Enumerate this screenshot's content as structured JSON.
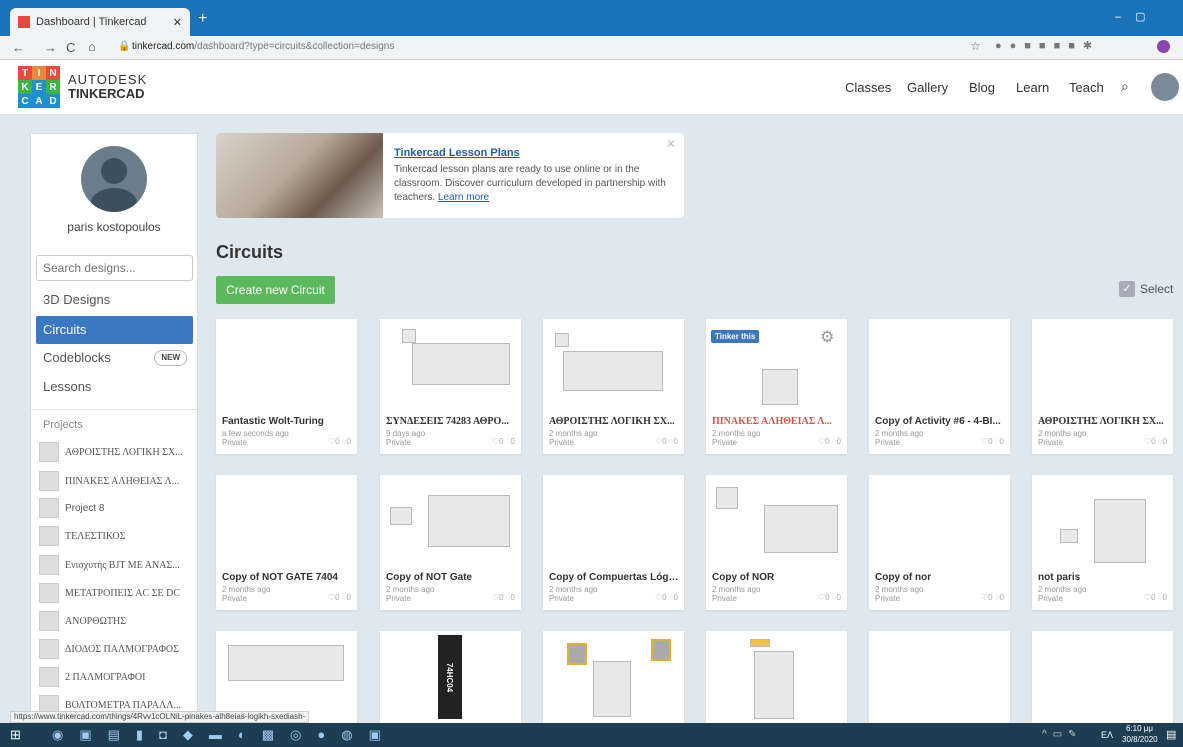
{
  "browser": {
    "tab_title": "Dashboard | Tinkercad",
    "url_host": "tinkercad.com",
    "url_path": "/dashboard?type=circuits&collection=designs",
    "status_url": "https://www.tinkercad.com/things/4Rvv1cOLNiL-pinakes-alh8eias-logikh-sxediash-"
  },
  "header": {
    "logo_letters": [
      "T",
      "I",
      "N",
      "K",
      "E",
      "R",
      "C",
      "A",
      "D"
    ],
    "brand_line1": "AUTODESK",
    "brand_line2": "TINKERCAD",
    "nav": [
      "Classes",
      "Gallery",
      "Blog",
      "Learn",
      "Teach"
    ]
  },
  "sidebar": {
    "username": "paris kostopoulos",
    "search_placeholder": "Search designs...",
    "items": [
      "3D Designs",
      "Circuits",
      "Codeblocks",
      "Lessons"
    ],
    "new_badge": "NEW",
    "projects_label": "Projects",
    "projects": [
      "ΑΘΡΟΙΣΤΗΣ ΛΟΓΙΚΗ ΣΧ...",
      "ΠΙΝΑΚΕΣ ΑΛΗΘΕΙΑΣ Λ...",
      "Project 8",
      "ΤΕΛΕΣΤΙΚΟΣ",
      "Ενισχυτής BJT ΜΕ ΑΝΑΣ...",
      "ΜΕΤΑΤΡΟΠΕΙΣ AC ΣΕ DC",
      "ΑΝΟΡΘΩΤΗΣ",
      "ΔΙΟΔΟΣ ΠΑΛΜΟΓΡΑΦΟΣ",
      "2 ΠΑΛΜΟΓΡΑΦΟΙ",
      "ΒΟΛΤΟΜΕΤΡΑ ΠΑΡΑΛΛ..."
    ]
  },
  "banner": {
    "title": "Tinkercad Lesson Plans",
    "body": "Tinkercad lesson plans are ready to use online or in the classroom. Discover curriculum developed in partnership with teachers.",
    "link": "Learn more"
  },
  "main": {
    "heading": "Circuits",
    "create_button": "Create new Circuit",
    "select_label": "Select",
    "tinker_badge": "Tinker this",
    "stats": "♡0 ◌0"
  },
  "cards": [
    {
      "title": "Fantastic Wolt-Turing",
      "date": "a few seconds ago",
      "privacy": "Private"
    },
    {
      "title": "ΣΥΝΔΕΣΕΙΣ 74283 ΑΘΡΟ...",
      "date": "9 days ago",
      "privacy": "Private"
    },
    {
      "title": "ΑΘΡΟΙΣΤΗΣ ΛΟΓΙΚΗ ΣΧ...",
      "date": "2 months ago",
      "privacy": "Private"
    },
    {
      "title": "ΠΙΝΑΚΕΣ ΑΛΗΘΕΙΑΣ Λ...",
      "date": "2 months ago",
      "privacy": "Private"
    },
    {
      "title": "Copy of Activity #6 - 4-BI...",
      "date": "2 months ago",
      "privacy": "Private"
    },
    {
      "title": "ΑΘΡΟΙΣΤΗΣ ΛΟΓΙΚΗ ΣΧ...",
      "date": "2 months ago",
      "privacy": "Private"
    },
    {
      "title": "Copy of NOT GATE 7404",
      "date": "2 months ago",
      "privacy": "Private"
    },
    {
      "title": "Copy of NOT Gate",
      "date": "2 months ago",
      "privacy": "Private"
    },
    {
      "title": "Copy of Compuertas Lógi...",
      "date": "2 months ago",
      "privacy": "Private"
    },
    {
      "title": "Copy of NOR",
      "date": "2 months ago",
      "privacy": "Private"
    },
    {
      "title": "Copy of nor",
      "date": "2 months ago",
      "privacy": "Private"
    },
    {
      "title": "not paris",
      "date": "2 months ago",
      "privacy": "Private"
    }
  ],
  "chip_label": "74HC04",
  "taskbar": {
    "lang": "ΕΛ",
    "time": "6:10 μμ",
    "date": "30/8/2020"
  }
}
